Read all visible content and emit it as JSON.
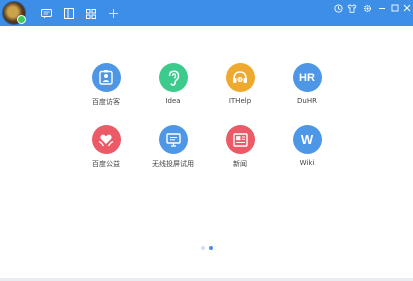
{
  "colors": {
    "titlebar": "#3d8ee6",
    "visitor": "#4e97e6",
    "idea": "#3ccb8d",
    "ithelp": "#f0a92f",
    "duhr": "#4e97e6",
    "charity": "#ec5a68",
    "wifi": "#4e97e6",
    "news": "#ec5a68",
    "wiki": "#4e97e6"
  },
  "apps": [
    {
      "label": "百度访客",
      "icon": "visitor-badge-icon"
    },
    {
      "label": "Idea",
      "icon": "ear-icon"
    },
    {
      "label": "ITHelp",
      "icon": "headset-icon"
    },
    {
      "label": "DuHR",
      "icon": "hr-icon",
      "glyph": "HR"
    },
    {
      "label": "百度公益",
      "icon": "heart-hands-icon"
    },
    {
      "label": "无线投屏试用",
      "icon": "screen-cast-icon"
    },
    {
      "label": "新闻",
      "icon": "newspaper-icon"
    },
    {
      "label": "Wiki",
      "icon": "wiki-icon",
      "glyph": "W"
    }
  ],
  "pager": {
    "pages": 2,
    "active": 2
  }
}
